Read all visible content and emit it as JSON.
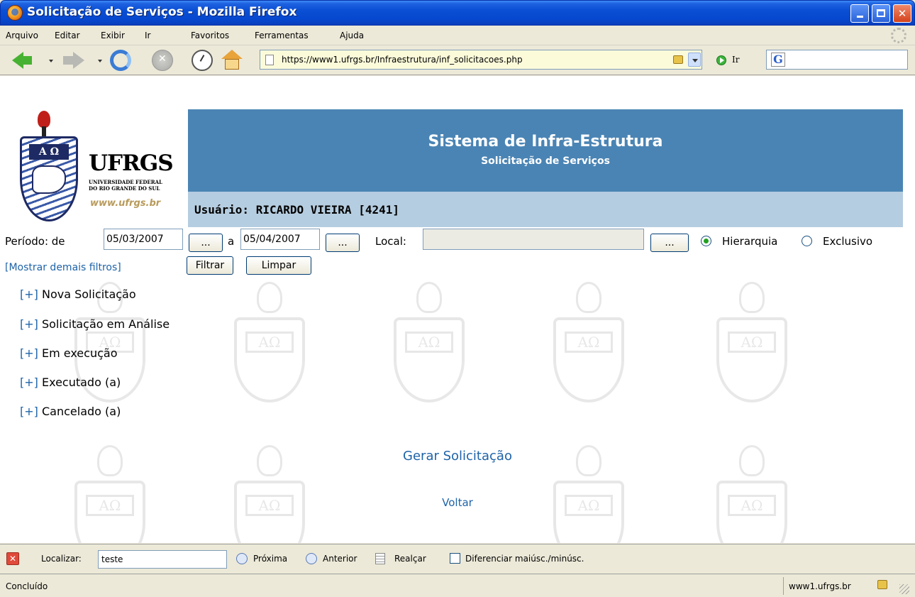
{
  "window": {
    "title": "Solicitação de Serviços - Mozilla Firefox"
  },
  "menu": [
    "Arquivo",
    "Editar",
    "Exibir",
    "Ir",
    "Favoritos",
    "Ferramentas",
    "Ajuda"
  ],
  "navbar": {
    "url": "https://www1.ufrgs.br/Infraestrutura/inf_solicitacoes.php",
    "go_label": "Ir",
    "search_value": ""
  },
  "logo": {
    "name": "UFRGS",
    "sub1": "UNIVERSIDADE FEDERAL",
    "sub2": "DO RIO GRANDE DO SUL",
    "site": "www.ufrgs.br"
  },
  "header": {
    "title": "Sistema de Infra-Estrutura",
    "subtitle": "Solicitação de Serviços",
    "user": "Usuário: RICARDO VIEIRA [4241]"
  },
  "filters": {
    "period_label": "Período: de",
    "date_from": "05/03/2007",
    "a_label": "a",
    "date_to": "05/04/2007",
    "picker_label": "...",
    "local_label": "Local:",
    "local_value": "",
    "local_picker_label": "...",
    "radio_hierarquia": "Hierarquia",
    "radio_exclusivo": "Exclusivo",
    "selected_radio": "Hierarquia",
    "more_filters": "[Mostrar demais filtros]",
    "filter_button": "Filtrar",
    "clear_button": "Limpar"
  },
  "categories": [
    {
      "plus": "[+]",
      "label": "Nova Solicitação"
    },
    {
      "plus": "[+]",
      "label": "Solicitação em Análise"
    },
    {
      "plus": "[+]",
      "label": "Em execução"
    },
    {
      "plus": "[+]",
      "label": "Executado (a)"
    },
    {
      "plus": "[+]",
      "label": "Cancelado (a)"
    }
  ],
  "actions": {
    "generate": "Gerar Solicitação",
    "back": "Voltar"
  },
  "findbar": {
    "label": "Localizar:",
    "value": "teste",
    "next": "Próxima",
    "previous": "Anterior",
    "highlight": "Realçar",
    "match_case": "Diferenciar maiúsc./minúsc."
  },
  "status": {
    "text": "Concluído",
    "domain": "www1.ufrgs.br"
  },
  "colors": {
    "banner": "#4a84b4",
    "userbar": "#b5cde0",
    "link": "#1e63a8"
  }
}
